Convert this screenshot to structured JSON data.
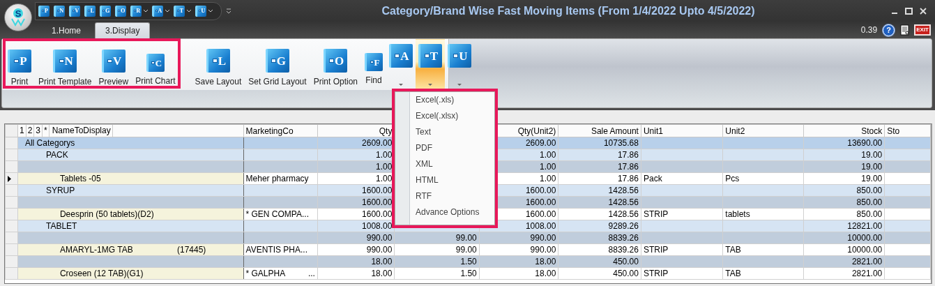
{
  "window": {
    "logo_letter": "S",
    "title": "Category/Brand Wise Fast Moving Items (From 1/4/2022 Upto 4/5/2022)"
  },
  "quick_access": [
    {
      "letter": "P",
      "dropdown": false
    },
    {
      "letter": "N",
      "dropdown": false
    },
    {
      "letter": "V",
      "dropdown": false
    },
    {
      "letter": "L",
      "dropdown": false
    },
    {
      "letter": "G",
      "dropdown": false
    },
    {
      "letter": "O",
      "dropdown": false
    },
    {
      "letter": "R",
      "dropdown": true
    },
    {
      "letter": "A",
      "dropdown": true
    },
    {
      "letter": "T",
      "dropdown": true
    },
    {
      "letter": "U",
      "dropdown": true
    }
  ],
  "tabs": [
    {
      "label": "1.Home",
      "selected": false
    },
    {
      "label": "3.Display",
      "selected": true
    }
  ],
  "status": {
    "version": "0.39",
    "help_label": "?",
    "exit_label": "EXIT"
  },
  "ribbon": {
    "groups": [
      {
        "highlighted": true,
        "buttons": [
          {
            "letter": "P",
            "label": "Print",
            "kind": "large",
            "pressed": false
          },
          {
            "letter": "N",
            "label": "Print Template",
            "kind": "large",
            "pressed": false
          },
          {
            "letter": "V",
            "label": "Preview",
            "kind": "large",
            "pressed": false
          },
          {
            "letter": "C",
            "label": "Print Chart",
            "kind": "small",
            "pressed": false
          }
        ]
      },
      {
        "highlighted": false,
        "buttons": [
          {
            "letter": "L",
            "label": "Save Layout",
            "kind": "large",
            "pressed": false
          },
          {
            "letter": "G",
            "label": "Set Grid Layout",
            "kind": "large",
            "pressed": false
          },
          {
            "letter": "O",
            "label": "Print Option",
            "kind": "large",
            "pressed": false
          },
          {
            "letter": "F",
            "label": "Find",
            "kind": "small",
            "pressed": false
          },
          {
            "letter": "A",
            "kind": "split",
            "pressed": false
          },
          {
            "letter": "T",
            "kind": "split",
            "pressed": true
          },
          {
            "letter": "U",
            "kind": "split",
            "pressed": false
          }
        ]
      }
    ]
  },
  "export_menu": {
    "highlighted": true,
    "items": [
      "Excel(.xls)",
      "Excel(.xlsx)",
      "Text",
      "PDF",
      "XML",
      "HTML",
      "RTF",
      "Advance Options"
    ]
  },
  "grid": {
    "level_buttons": [
      "1",
      "2",
      "3",
      "*"
    ],
    "columns": [
      "NameToDisplay",
      "MarketingCo",
      "Qty",
      "Qty(Unit2)",
      "Sale Amount",
      "Unit1",
      "Unit2",
      "Stock",
      "Sto"
    ],
    "rows": [
      {
        "kind": "total",
        "selected": false,
        "name": "All Categorys",
        "qty": "2609.00",
        "qty_unit2": "2609.00",
        "sale_amount": "10735.68",
        "stock": "13690.00"
      },
      {
        "kind": "group",
        "selected": false,
        "name": "PACK",
        "qty": "1.00",
        "qty_unit2": "1.00",
        "sale_amount": "17.86",
        "stock": "19.00"
      },
      {
        "kind": "subtotal",
        "selected": false,
        "qty": "1.00",
        "qty_unit2": "1.00",
        "sale_amount": "17.86",
        "stock": "19.00"
      },
      {
        "kind": "item",
        "selected": true,
        "name": "Tablets -05",
        "marketing_co": "Meher pharmacy",
        "qty": "1.00",
        "qty_unit2": "1.00",
        "sale_amount": "17.86",
        "unit1": "Pack",
        "unit2": "Pcs",
        "stock": "19.00"
      },
      {
        "kind": "group",
        "selected": false,
        "name": "SYRUP",
        "qty": "1600.00",
        "qty_unit2": "1600.00",
        "sale_amount": "1428.56",
        "stock": "850.00"
      },
      {
        "kind": "subtotal",
        "selected": false,
        "qty": "1600.00",
        "qty_unit2": "1600.00",
        "sale_amount": "1428.56",
        "stock": "850.00"
      },
      {
        "kind": "item",
        "selected": false,
        "name": "Deesprin (50 tablets)(D2)",
        "marketing_co": "* GEN COMPA...",
        "qty": "1600.00",
        "qty_unit2": "1600.00",
        "sale_amount": "1428.56",
        "unit1": "STRIP",
        "unit2": "tablets",
        "stock": "850.00"
      },
      {
        "kind": "group",
        "selected": false,
        "name": "TABLET",
        "qty": "1008.00",
        "qty_unit2": "1008.00",
        "sale_amount": "9289.26",
        "stock": "12821.00"
      },
      {
        "kind": "subtotal",
        "selected": false,
        "qty": "990.00",
        "column_4": "99.00",
        "qty_unit2": "990.00",
        "sale_amount": "8839.26",
        "stock": "10000.00"
      },
      {
        "kind": "item",
        "selected": false,
        "name": "AMARYL-1MG TAB                   (17445)",
        "marketing_co": "AVENTIS PHA...",
        "qty": "990.00",
        "column_4": "99.00",
        "qty_unit2": "990.00",
        "sale_amount": "8839.26",
        "unit1": "STRIP",
        "unit2": "TAB",
        "stock": "10000.00"
      },
      {
        "kind": "subtotal",
        "selected": false,
        "qty": "18.00",
        "column_4": "1.50",
        "qty_unit2": "18.00",
        "sale_amount": "450.00",
        "stock": "2821.00"
      },
      {
        "kind": "item",
        "selected": false,
        "name": "Croseen (12 TAB)(G1)",
        "marketing_co": "* GALPHA          ...",
        "qty": "18.00",
        "column_4": "1.50",
        "qty_unit2": "18.00",
        "sale_amount": "450.00",
        "unit1": "STRIP",
        "unit2": "TAB",
        "stock": "2821.00"
      }
    ]
  }
}
